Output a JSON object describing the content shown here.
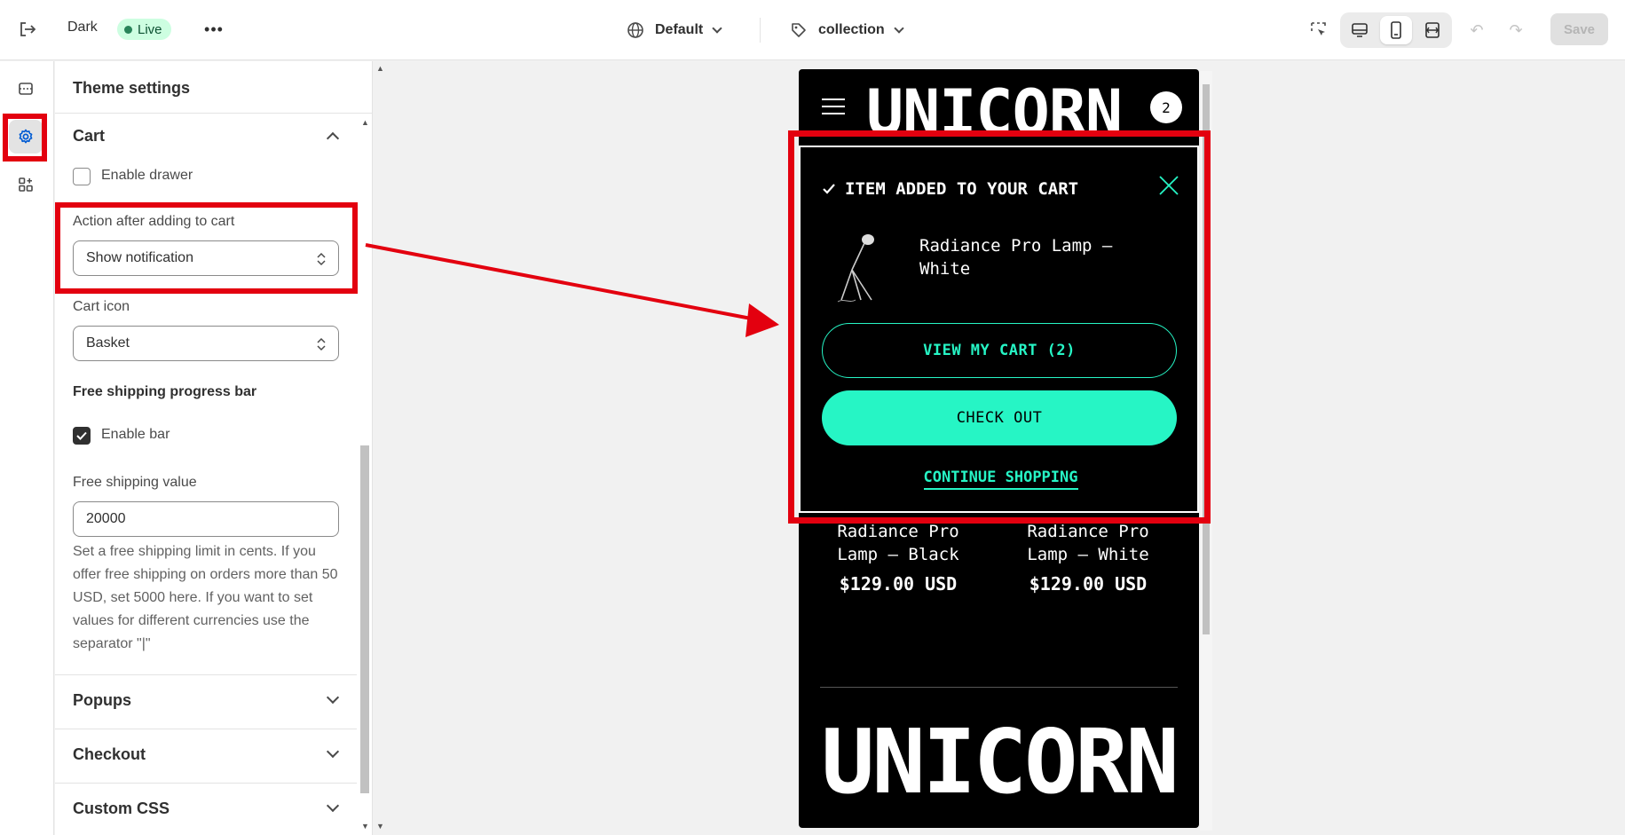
{
  "topbar": {
    "theme_name": "Dark",
    "live_badge": "Live",
    "more_label": "•••",
    "language_selector": "Default",
    "template_selector": "collection",
    "undo_label": "↶",
    "redo_label": "↷",
    "save_label": "Save"
  },
  "panel": {
    "title": "Theme settings",
    "cart_section": {
      "heading": "Cart",
      "enable_drawer_label": "Enable drawer",
      "enable_drawer_checked": false,
      "action_label": "Action after adding to cart",
      "action_value": "Show notification",
      "cart_icon_label": "Cart icon",
      "cart_icon_value": "Basket",
      "free_shipping_heading": "Free shipping progress bar",
      "enable_bar_label": "Enable bar",
      "enable_bar_checked": true,
      "free_shipping_value_label": "Free shipping value",
      "free_shipping_value": "20000",
      "help_text": "Set a free shipping limit in cents. If you offer free shipping on orders more than 50 USD, set 5000 here. If you want to set values for different currencies use the separator \"|\""
    },
    "popups_heading": "Popups",
    "checkout_heading": "Checkout",
    "custom_css_heading": "Custom CSS"
  },
  "preview": {
    "logo": "UNICORN",
    "cart_count": "2",
    "notification": {
      "title": "ITEM ADDED TO YOUR CART",
      "product_name": "Radiance Pro Lamp — White",
      "view_cart_button": "VIEW MY CART (2)",
      "checkout_button": "CHECK OUT",
      "continue_link": "CONTINUE SHOPPING"
    },
    "products": [
      {
        "title": "Radiance Pro Lamp — Black",
        "price": "$129.00 USD"
      },
      {
        "title": "Radiance Pro Lamp — White",
        "price": "$129.00 USD"
      }
    ],
    "footer_logo": "UNICORN"
  },
  "colors": {
    "accent": "#26f5c5",
    "highlight": "#e3000f",
    "active_icon": "#005bd3"
  }
}
